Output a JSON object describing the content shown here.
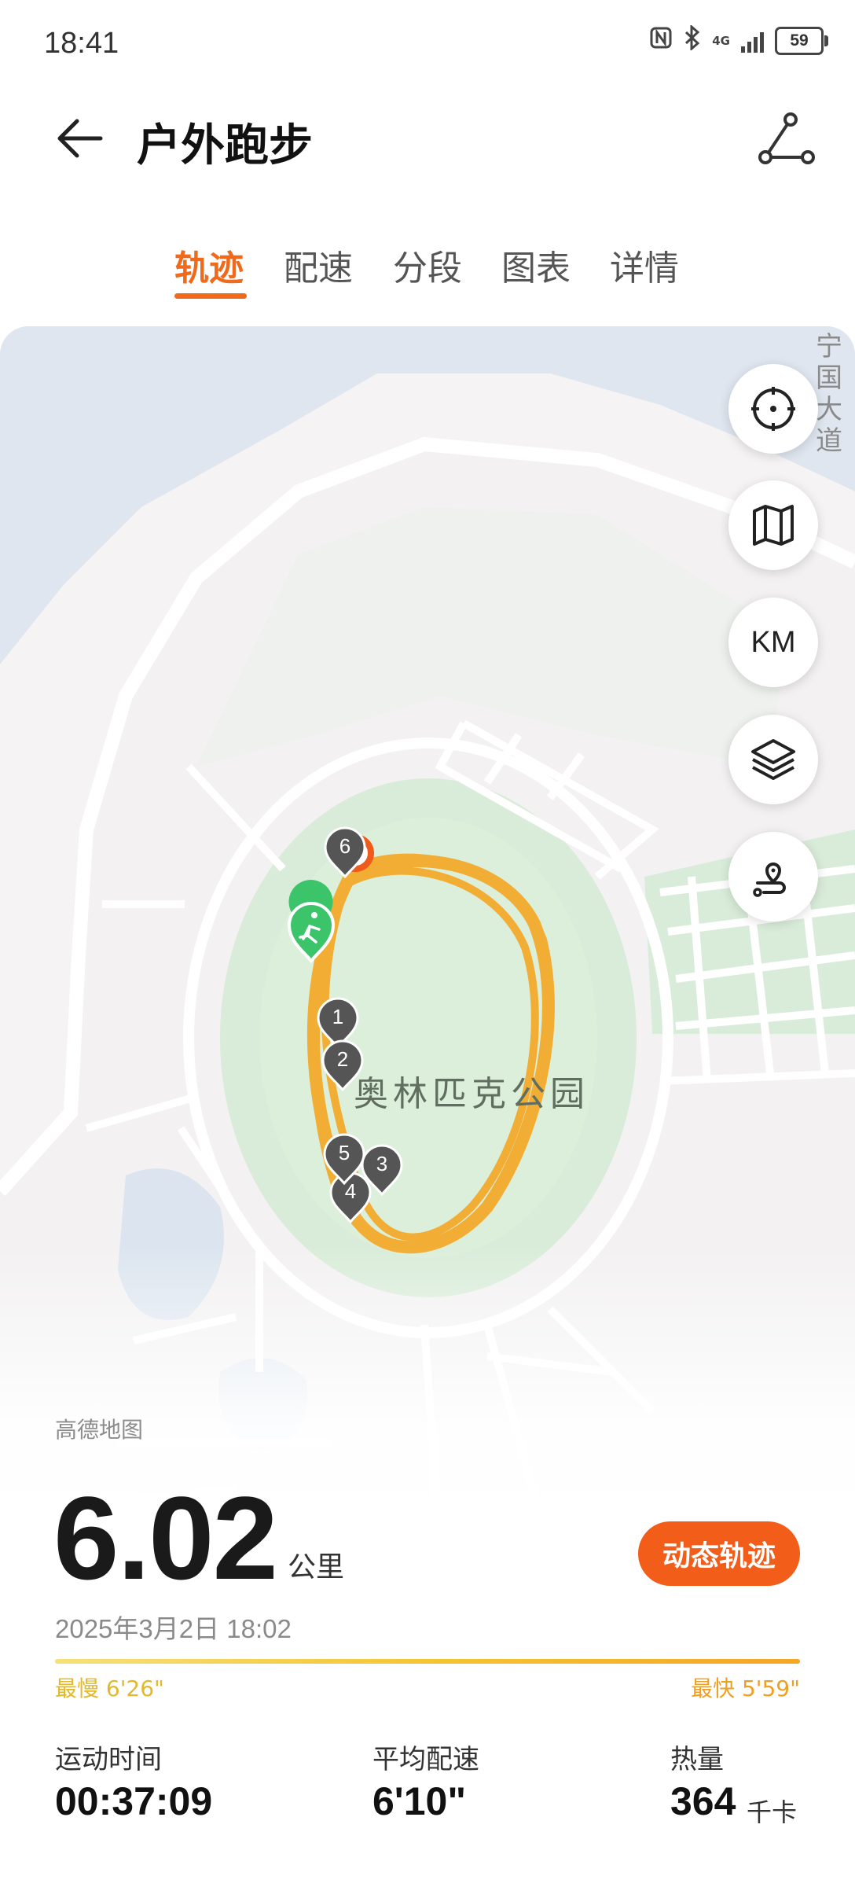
{
  "status_bar": {
    "time": "18:41",
    "network": "4G",
    "battery": "59"
  },
  "header": {
    "title": "户外跑步"
  },
  "tabs": [
    {
      "label": "轨迹",
      "active": true
    },
    {
      "label": "配速",
      "active": false
    },
    {
      "label": "分段",
      "active": false
    },
    {
      "label": "图表",
      "active": false
    },
    {
      "label": "详情",
      "active": false
    }
  ],
  "map": {
    "road_label": "宁国大道",
    "park_label": "奥林匹克公园",
    "source": "高德地图",
    "controls": [
      "locate-icon",
      "map-icon",
      "KM",
      "layers-icon",
      "route-replay-icon"
    ],
    "km_label": "KM",
    "km_markers": [
      "1",
      "2",
      "3",
      "4",
      "5",
      "6"
    ],
    "track_color": "#f5a623",
    "start_color": "#3cc46a",
    "end_color": "#f05a1a"
  },
  "summary": {
    "distance": "6.02",
    "distance_unit": "公里",
    "dynamic_button": "动态轨迹",
    "date": "2025年3月2日 18:02",
    "slowest": "最慢 6'26\"",
    "fastest": "最快 5'59\""
  },
  "stats": [
    {
      "label": "运动时间",
      "value": "00:37:09",
      "unit": ""
    },
    {
      "label": "平均配速",
      "value": "6'10\"",
      "unit": ""
    },
    {
      "label": "热量",
      "value": "364",
      "unit": "千卡"
    }
  ],
  "colors": {
    "accent": "#f06a1c",
    "button": "#f25e1a"
  }
}
